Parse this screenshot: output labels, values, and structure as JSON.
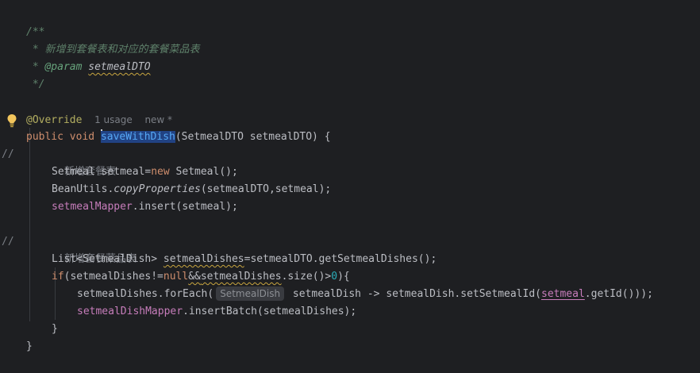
{
  "editor": {
    "doc_open": "/**",
    "doc_line1": " * 新增到套餐表和对应的套餐菜品表",
    "doc_star": " * ",
    "doc_param_tag": "@param",
    "doc_param_name": "setmealDTO",
    "doc_close": " */",
    "annotation": "@Override",
    "usage_hint": "1 usage",
    "new_hint": "new *",
    "method": {
      "kw_public": "public",
      "kw_void": "void",
      "name": "saveWithDish",
      "params": "(SetmealDTO setmealDTO) {"
    },
    "comment1_marker": "//",
    "comment1_text": "新增套餐表",
    "line_setmeal_a": "Setmeal setmeal=",
    "line_setmeal_new": "new",
    "line_setmeal_b": " Setmeal();",
    "line_beanutils_a": "BeanUtils.",
    "line_beanutils_method": "copyProperties",
    "line_beanutils_b": "(setmealDTO,setmeal);",
    "line_mapper_field": "setmealMapper",
    "line_mapper_b": ".insert(setmeal);",
    "comment2_marker": "//",
    "comment2_text": "新增套餐菜品表",
    "line_list_a": "List<SetmealDish> ",
    "line_list_var": "setmealDishes",
    "line_list_b": "=setmealDTO.getSetmealDishes();",
    "line_if_kw": "if",
    "line_if_a": "(setmealDishes!=",
    "line_if_null": "null",
    "line_if_amp": "&&",
    "line_if_var": "setmealDishes",
    "line_if_b": ".size()>",
    "line_if_zero": "0",
    "line_if_c": "){",
    "line_foreach_a": "setmealDishes.forEach(",
    "line_foreach_inlay": "SetmealDish",
    "line_foreach_b": " setmealDish -> setmealDish.setSetmealId(",
    "line_foreach_var": "setmeal",
    "line_foreach_c": ".getId()));",
    "line_batch_field": "setmealDishMapper",
    "line_batch_b": ".insertBatch(setmealDishes);",
    "close_inner": "}",
    "close_outer": "}"
  },
  "colors": {
    "background": "#1e1f22",
    "keyword": "#cf8e6d",
    "method_declaration": "#56a8f5",
    "annotation": "#b3ae60",
    "field": "#c77dbb",
    "number": "#2aacb8",
    "doc_comment": "#5f826b",
    "line_comment": "#7a7e85",
    "bulb": "#f2c55c"
  },
  "icons": {
    "gutter_bulb": "lightbulb-icon"
  }
}
